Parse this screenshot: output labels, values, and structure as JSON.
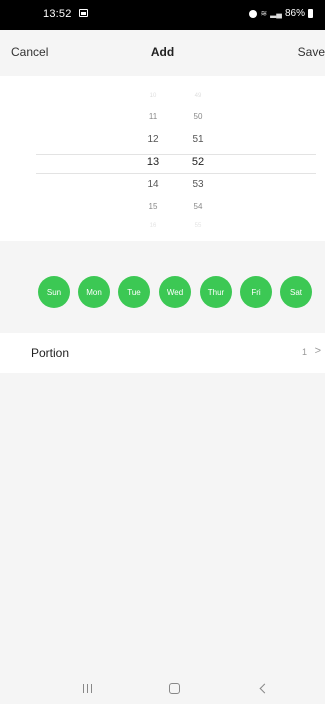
{
  "status_bar": {
    "time": "13:52",
    "battery": "86%"
  },
  "header": {
    "cancel_label": "Cancel",
    "title": "Add",
    "save_label": "Save"
  },
  "picker": {
    "hours": [
      "10",
      "11",
      "12",
      "13",
      "14",
      "15",
      "16"
    ],
    "minutes": [
      "49",
      "50",
      "51",
      "52",
      "53",
      "54",
      "55"
    ],
    "selected_hour": "13",
    "selected_minute": "52"
  },
  "days": [
    {
      "label": "Sun",
      "selected": true
    },
    {
      "label": "Mon",
      "selected": true
    },
    {
      "label": "Tue",
      "selected": true
    },
    {
      "label": "Wed",
      "selected": true
    },
    {
      "label": "Thur",
      "selected": true
    },
    {
      "label": "Fri",
      "selected": true
    },
    {
      "label": "Sat",
      "selected": true
    }
  ],
  "portion": {
    "label": "Portion",
    "value": "1"
  },
  "colors": {
    "accent_green": "#3cc854",
    "background": "#f5f5f5"
  },
  "icons": {
    "chevron": "chevron-right-icon",
    "nav_recent": "recent-apps-icon",
    "nav_home": "home-icon",
    "nav_back": "back-icon"
  }
}
